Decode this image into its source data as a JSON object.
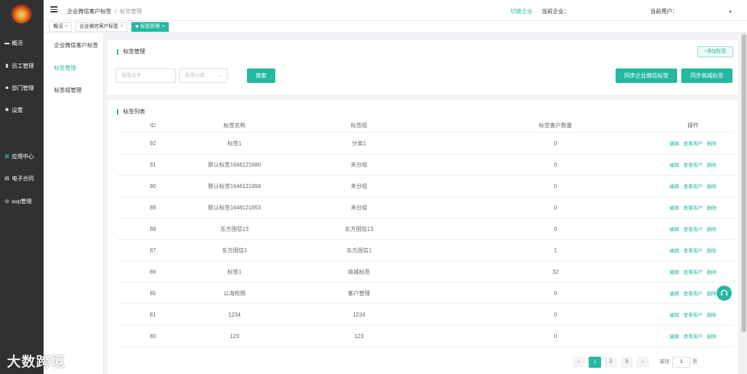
{
  "sidebar": {
    "items": [
      {
        "label": "概况",
        "icon": "monitor-icon"
      },
      {
        "label": "员工管理",
        "icon": "user-icon"
      },
      {
        "label": "部门管理",
        "icon": "org-icon"
      },
      {
        "label": "设置",
        "icon": "gear-icon"
      },
      {
        "label": "应用中心",
        "icon": "apps-icon"
      },
      {
        "label": "电子合同",
        "icon": "document-icon"
      },
      {
        "label": "sop管理",
        "icon": "database-icon"
      }
    ]
  },
  "subnav": {
    "items": [
      {
        "label": "企业微信客户标签"
      },
      {
        "label": "标签管理"
      },
      {
        "label": "标签组管理"
      }
    ]
  },
  "header": {
    "breadcrumb": [
      "企业微信客户标签",
      "标签管理"
    ],
    "switch_company": "切换企业",
    "current_company_label": "当前企业：",
    "current_user_label": "当前用户："
  },
  "tabs": [
    {
      "label": "概况"
    },
    {
      "label": "企业微信客户标签"
    },
    {
      "label": "标签管理"
    }
  ],
  "filter": {
    "title": "标签管理",
    "add_button": "+添加标签",
    "name_placeholder": "标签名字",
    "category_placeholder": "标签分类",
    "search_button": "搜索",
    "sync_wechat_button": "同步企业微信标签",
    "sync_mall_button": "同步商城标签"
  },
  "table": {
    "title": "标签列表",
    "columns": [
      "ID",
      "标签名称",
      "标签组",
      "标签客户数量",
      "操作"
    ],
    "actions": [
      "编辑",
      "查看客户",
      "删除"
    ],
    "rows": [
      {
        "id": "92",
        "name": "标签1",
        "group": "分类1",
        "count": "0"
      },
      {
        "id": "91",
        "name": "默认标签1646121680",
        "group": "未分组",
        "count": "0"
      },
      {
        "id": "90",
        "name": "默认标签1646121894",
        "group": "未分组",
        "count": "0"
      },
      {
        "id": "89",
        "name": "默认标签1646121853",
        "group": "未分组",
        "count": "0"
      },
      {
        "id": "88",
        "name": "东方国信13",
        "group": "东方国信13",
        "count": "0"
      },
      {
        "id": "87",
        "name": "东方国信1",
        "group": "东方国信1",
        "count": "1"
      },
      {
        "id": "86",
        "name": "标签1",
        "group": "商城标签",
        "count": "32"
      },
      {
        "id": "85",
        "name": "公海权限",
        "group": "客户管理",
        "count": "0"
      },
      {
        "id": "81",
        "name": "1234",
        "group": "1234",
        "count": "0"
      },
      {
        "id": "80",
        "name": "123",
        "group": "123",
        "count": "0"
      }
    ]
  },
  "pagination": {
    "prev": "‹",
    "pages": [
      "1",
      "2",
      "3"
    ],
    "next": "›",
    "goto_label": "前往",
    "goto_value": "1",
    "page_suffix": "页"
  },
  "watermark": "大数跨境",
  "colors": {
    "accent": "#25b9a0",
    "sidebar_bg": "#2f3133"
  }
}
